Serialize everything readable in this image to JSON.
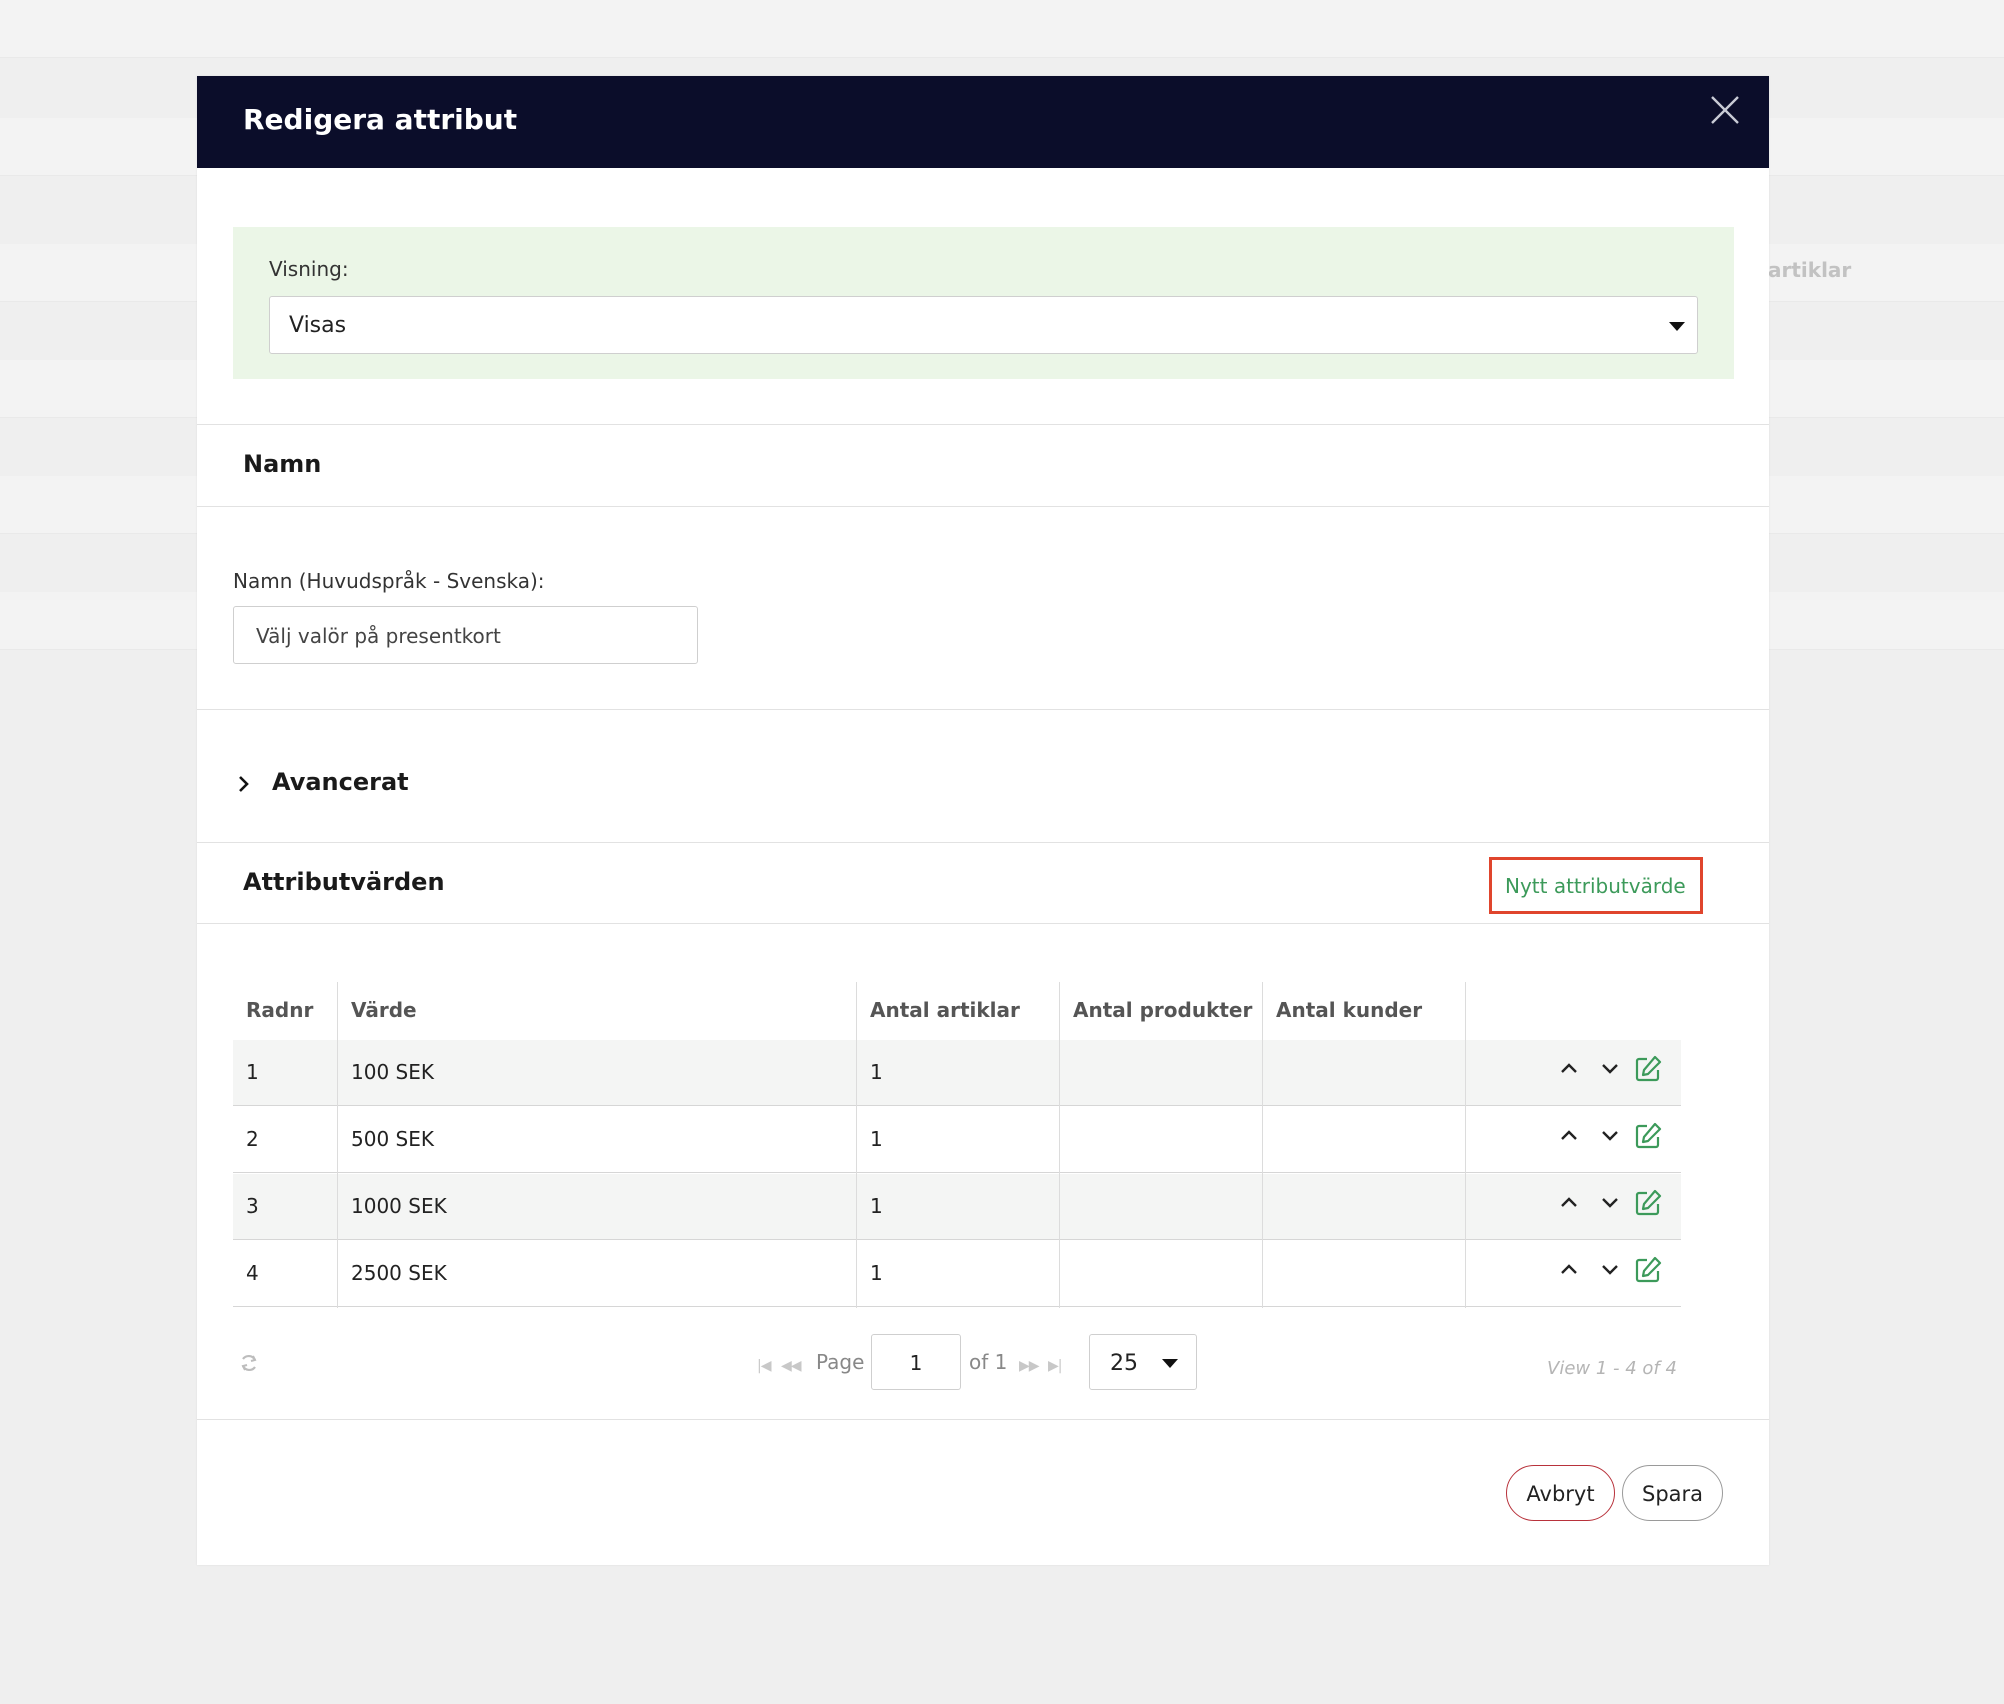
{
  "background": {
    "partial_text": "artiklar"
  },
  "modal": {
    "title": "Redigera attribut",
    "visning": {
      "label": "Visning:",
      "value": "Visas"
    },
    "namn_section": {
      "title": "Namn",
      "field_label": "Namn (Huvudspråk - Svenska):",
      "field_value": "Välj valör på presentkort"
    },
    "advanced": {
      "title": "Avancerat"
    },
    "attribute_values": {
      "title": "Attributvärden",
      "new_button": "Nytt attributvärde",
      "columns": [
        "Radnr",
        "Värde",
        "Antal artiklar",
        "Antal produkter",
        "Antal kunder"
      ],
      "rows": [
        {
          "radnr": "1",
          "varde": "100 SEK",
          "antal_artiklar": "1",
          "antal_produkter": "",
          "antal_kunder": ""
        },
        {
          "radnr": "2",
          "varde": "500 SEK",
          "antal_artiklar": "1",
          "antal_produkter": "",
          "antal_kunder": ""
        },
        {
          "radnr": "3",
          "varde": "1000 SEK",
          "antal_artiklar": "1",
          "antal_produkter": "",
          "antal_kunder": ""
        },
        {
          "radnr": "4",
          "varde": "2500 SEK",
          "antal_artiklar": "1",
          "antal_produkter": "",
          "antal_kunder": ""
        }
      ],
      "row_actions": [
        "move-up-icon",
        "move-down-icon",
        "edit-icon"
      ]
    },
    "pager": {
      "page_label": "Page",
      "page_value": "1",
      "of_label": "of 1",
      "page_size": "25",
      "view_text": "View 1 - 4 of 4"
    },
    "footer": {
      "cancel_label": "Avbryt",
      "save_label": "Spara"
    }
  },
  "colors": {
    "header_bg": "#0b0d2a",
    "visning_bg": "#ebf6e7",
    "accent_green": "#3c9a5a",
    "highlight_red": "#e0452d",
    "cancel_border": "#b8323b"
  }
}
